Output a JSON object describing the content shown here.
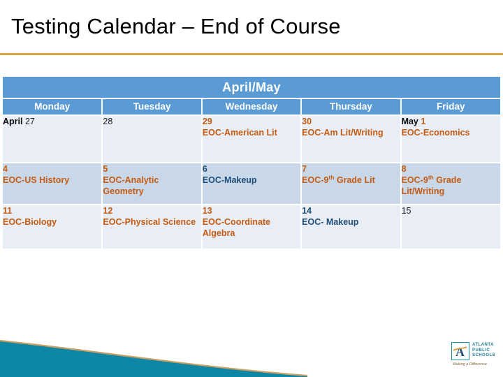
{
  "slide": {
    "title": "Testing Calendar – End of Course",
    "rule_color": "#D9A14A"
  },
  "calendar": {
    "month_banner": "April/May",
    "header_color": "#5B9BD5",
    "day_headers": [
      "Monday",
      "Tuesday",
      "Wednesday",
      "Thursday",
      "Friday"
    ],
    "rows": [
      {
        "shade": "light",
        "cells": [
          {
            "month_prefix": "April",
            "day": "27",
            "day_color": "dark",
            "event": "",
            "event_color": ""
          },
          {
            "month_prefix": "",
            "day": "28",
            "day_color": "dark",
            "event": "",
            "event_color": ""
          },
          {
            "month_prefix": "",
            "day": "29",
            "day_color": "orange",
            "event": "EOC-American Lit",
            "event_color": "orange"
          },
          {
            "month_prefix": "",
            "day": "30",
            "day_color": "orange",
            "event": "EOC-Am Lit/Writing",
            "event_color": "orange"
          },
          {
            "month_prefix": "May",
            "day": "1",
            "day_color": "orange",
            "event": "EOC-Economics",
            "event_color": "orange"
          }
        ]
      },
      {
        "shade": "dark",
        "cells": [
          {
            "month_prefix": "",
            "day": "4",
            "day_color": "orange",
            "event": "EOC-US History",
            "event_color": "orange"
          },
          {
            "month_prefix": "",
            "day": "5",
            "day_color": "orange",
            "event": "EOC-Analytic Geometry",
            "event_color": "orange"
          },
          {
            "month_prefix": "",
            "day": "6",
            "day_color": "blue",
            "event": "EOC-Makeup",
            "event_color": "blue"
          },
          {
            "month_prefix": "",
            "day": "7",
            "day_color": "orange",
            "event": "EOC-9th Grade Lit",
            "event_color": "orange",
            "event_sup": "th",
            "event_pre": "EOC-9",
            "event_post": " Grade Lit"
          },
          {
            "month_prefix": "",
            "day": "8",
            "day_color": "orange",
            "event": "EOC-9th Grade Lit/Writing",
            "event_color": "orange",
            "event_sup": "th",
            "event_pre": "EOC-9",
            "event_post": " Grade Lit/Writing"
          }
        ]
      },
      {
        "shade": "light",
        "cells": [
          {
            "month_prefix": "",
            "day": "11",
            "day_color": "orange",
            "event": "EOC-Biology",
            "event_color": "orange"
          },
          {
            "month_prefix": "",
            "day": "12",
            "day_color": "orange",
            "event": "EOC-Physical Science",
            "event_color": "orange"
          },
          {
            "month_prefix": "",
            "day": "13",
            "day_color": "orange",
            "event": "EOC-Coordinate Algebra",
            "event_color": "orange"
          },
          {
            "month_prefix": "",
            "day": "14",
            "day_color": "blue",
            "event": "EOC- Makeup",
            "event_color": "blue"
          },
          {
            "month_prefix": "",
            "day": "15",
            "day_color": "dark",
            "event": "",
            "event_color": ""
          }
        ]
      }
    ]
  },
  "footer": {
    "swoosh_color": "#0E87A6",
    "swoosh_edge_color": "#C9A063",
    "logo": {
      "letter": "A",
      "line1": "ATLANTA",
      "line2": "PUBLIC",
      "line3": "SCHOOLS",
      "tagline": "Making a Difference"
    }
  },
  "colors": {
    "orange": "#C55A11",
    "blue": "#1F4E79",
    "dark": "#1A1A1A",
    "row_light": "#E9EEF6",
    "row_dark": "#C9D8E9"
  }
}
